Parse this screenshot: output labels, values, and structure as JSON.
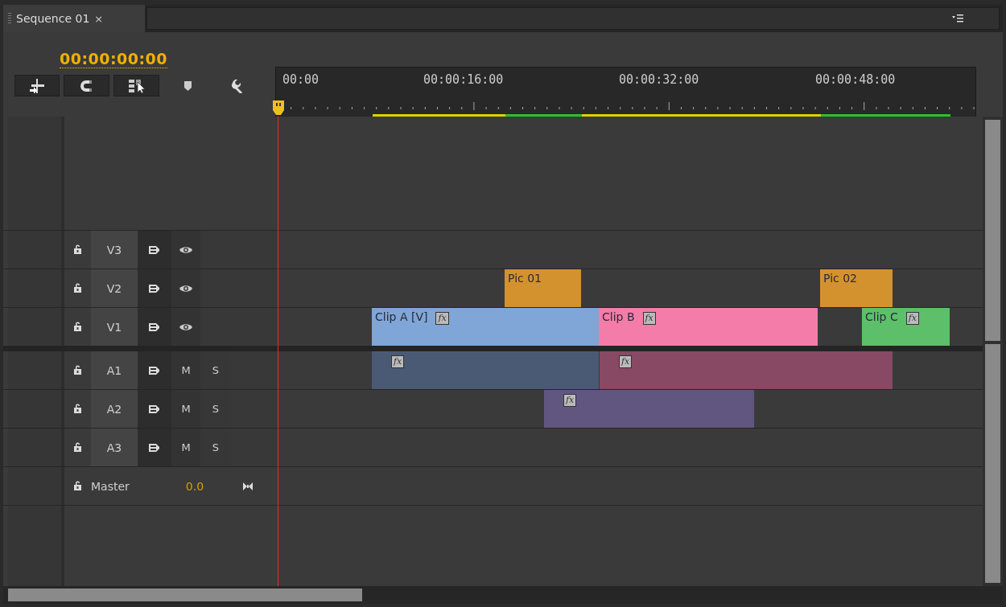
{
  "tab": {
    "title": "Sequence 01",
    "close": "×"
  },
  "timecode": "00:00:00:00",
  "ruler": {
    "labels": [
      "00:00",
      "00:00:16:00",
      "00:00:32:00",
      "00:00:48:00"
    ]
  },
  "video_tracks": [
    {
      "name": "V3"
    },
    {
      "name": "V2",
      "clips": [
        {
          "label": "Pic 01",
          "color": "#d4922e"
        },
        {
          "label": "Pic 02",
          "color": "#d4922e"
        }
      ]
    },
    {
      "name": "V1",
      "clips": [
        {
          "label": "Clip A [V]",
          "badge": "fx",
          "color": "#7fa6d6"
        },
        {
          "label": "Clip B",
          "badge": "fx",
          "color": "#f47ca8"
        },
        {
          "label": "Clip C",
          "badge": "fx",
          "color": "#5dbf6a"
        }
      ]
    }
  ],
  "audio_tracks": [
    {
      "name": "A1",
      "mute": "M",
      "solo": "S",
      "clips": [
        {
          "badge": "fx",
          "color": "#4a5a75"
        },
        {
          "badge": "fx",
          "color": "#874963"
        }
      ]
    },
    {
      "name": "A2",
      "mute": "M",
      "solo": "S",
      "clips": [
        {
          "badge": "fx",
          "color": "#615680"
        }
      ]
    },
    {
      "name": "A3",
      "mute": "M",
      "solo": "S"
    }
  ],
  "master": {
    "name": "Master",
    "value": "0.0"
  }
}
